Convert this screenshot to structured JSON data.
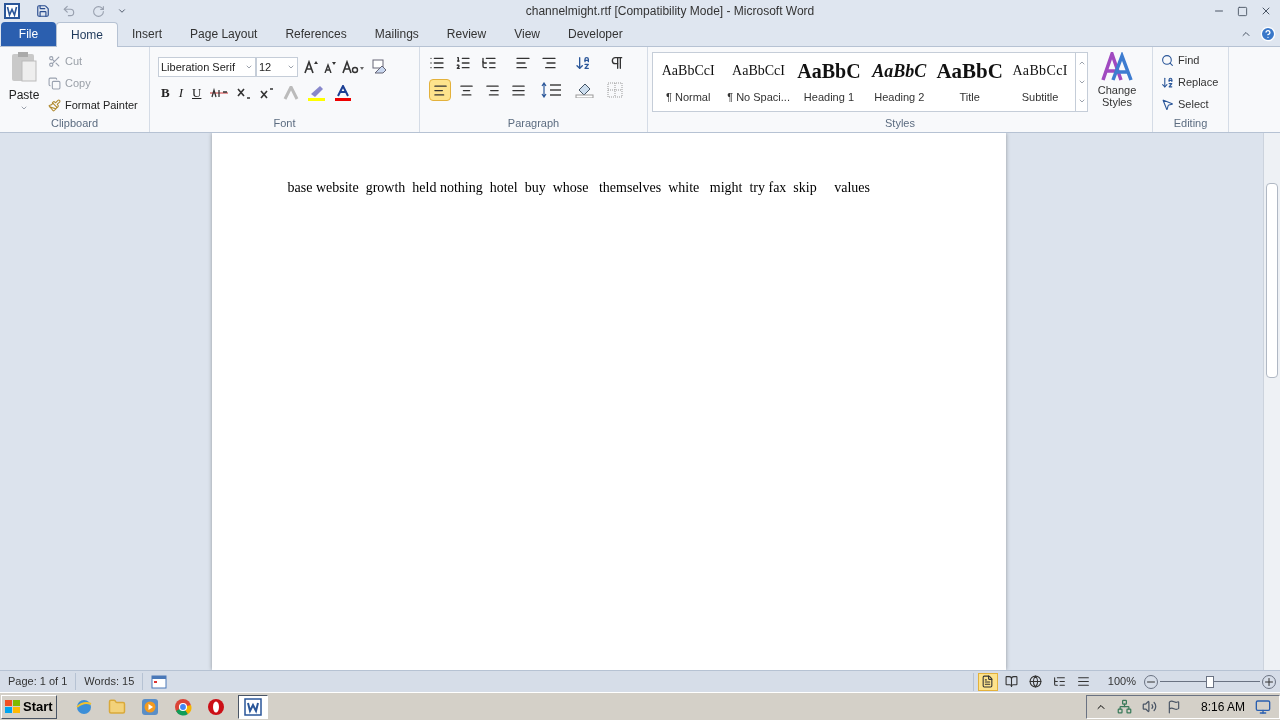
{
  "window": {
    "title": "channelmight.rtf [Compatibility Mode]  -  Microsoft Word"
  },
  "tabs": [
    {
      "label": "File",
      "kind": "file",
      "selected": false
    },
    {
      "label": "Home",
      "kind": "tab",
      "selected": true
    },
    {
      "label": "Insert",
      "kind": "tab",
      "selected": false
    },
    {
      "label": "Page Layout",
      "kind": "tab",
      "selected": false
    },
    {
      "label": "References",
      "kind": "tab",
      "selected": false
    },
    {
      "label": "Mailings",
      "kind": "tab",
      "selected": false
    },
    {
      "label": "Review",
      "kind": "tab",
      "selected": false
    },
    {
      "label": "View",
      "kind": "tab",
      "selected": false
    },
    {
      "label": "Developer",
      "kind": "tab",
      "selected": false
    }
  ],
  "clipboard": {
    "label": "Clipboard",
    "paste": "Paste",
    "items": [
      {
        "label": "Cut",
        "kind": "cut",
        "disabled": true
      },
      {
        "label": "Copy",
        "kind": "copy",
        "disabled": true
      },
      {
        "label": "Format Painter",
        "kind": "painter",
        "disabled": false
      }
    ]
  },
  "font": {
    "label": "Font",
    "name": "Liberation Serif",
    "size": "12",
    "formats": [
      {
        "label": "B",
        "kind": "bold"
      },
      {
        "label": "I",
        "kind": "italic"
      },
      {
        "label": "U",
        "kind": "underline"
      }
    ]
  },
  "paragraph": {
    "label": "Paragraph",
    "alignments": [
      {
        "kind": "left",
        "selected": true
      },
      {
        "kind": "center",
        "selected": false
      },
      {
        "kind": "right",
        "selected": false
      },
      {
        "kind": "justify",
        "selected": false
      }
    ]
  },
  "styles": {
    "label": "Styles",
    "items": [
      {
        "preview": "AaBbCcI",
        "label": "¶ Normal",
        "kind": "normal"
      },
      {
        "preview": "AaBbCcI",
        "label": "¶ No Spaci...",
        "kind": "normal"
      },
      {
        "preview": "AaBbC",
        "label": "Heading 1",
        "kind": "heading1"
      },
      {
        "preview": "AaBbC",
        "label": "Heading 2",
        "kind": "heading2"
      },
      {
        "preview": "AaBbC",
        "label": "Title",
        "kind": "title"
      },
      {
        "preview": "AaBbCcI",
        "label": "Subtitle",
        "kind": "subtitle"
      }
    ],
    "change_styles": "Change Styles"
  },
  "editing": {
    "label": "Editing",
    "items": [
      {
        "label": "Find",
        "kind": "find"
      },
      {
        "label": "Replace",
        "kind": "replace"
      },
      {
        "label": "Select",
        "kind": "select"
      }
    ]
  },
  "document": {
    "text": "base website  growth  held nothing  hotel  buy  whose   themselves  white   might  try fax  skip     values"
  },
  "status_bar": {
    "page": "Page: 1 of 1",
    "words": "Words: 15",
    "views": [
      {
        "kind": "print",
        "selected": true
      },
      {
        "kind": "reading",
        "selected": false
      },
      {
        "kind": "web",
        "selected": false
      },
      {
        "kind": "outline",
        "selected": false
      },
      {
        "kind": "draft",
        "selected": false
      }
    ],
    "zoom": "100%",
    "level": 0.5
  },
  "taskbar": {
    "start": "Start",
    "apps": [
      {
        "kind": "ie",
        "selected": false
      },
      {
        "kind": "explorer",
        "selected": false
      },
      {
        "kind": "media",
        "selected": false
      },
      {
        "kind": "chrome",
        "selected": false
      },
      {
        "kind": "opera",
        "selected": false
      },
      {
        "kind": "word",
        "selected": true
      }
    ],
    "clock": "8:16 AM"
  }
}
